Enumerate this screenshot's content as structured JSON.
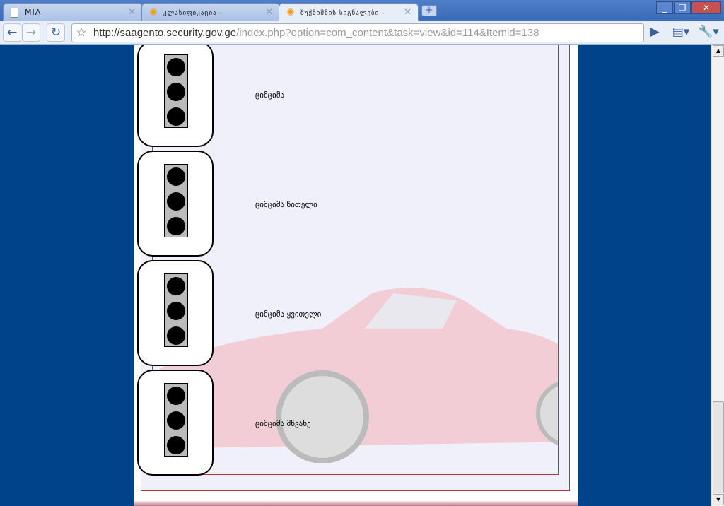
{
  "browser": {
    "tabs": [
      {
        "title": "MIA",
        "active": false
      },
      {
        "title": "კლასიფიკაცია -",
        "active": false
      },
      {
        "title": "შუქნიშნის სიგნალები -",
        "active": true
      }
    ],
    "url_host": "http://saagento.security.gov.ge",
    "url_path": "/index.php?option=com_content&task=view&id=114&Itemid=138"
  },
  "content": {
    "signals": [
      {
        "label": "ციმციმა"
      },
      {
        "label": "ციმციმა წითელი"
      },
      {
        "label": "ციმციმა ყვითელი"
      },
      {
        "label": "ციმციმა მწვანე"
      }
    ]
  },
  "colors": {
    "page_bg": "#00438a",
    "border": "#c03040"
  }
}
